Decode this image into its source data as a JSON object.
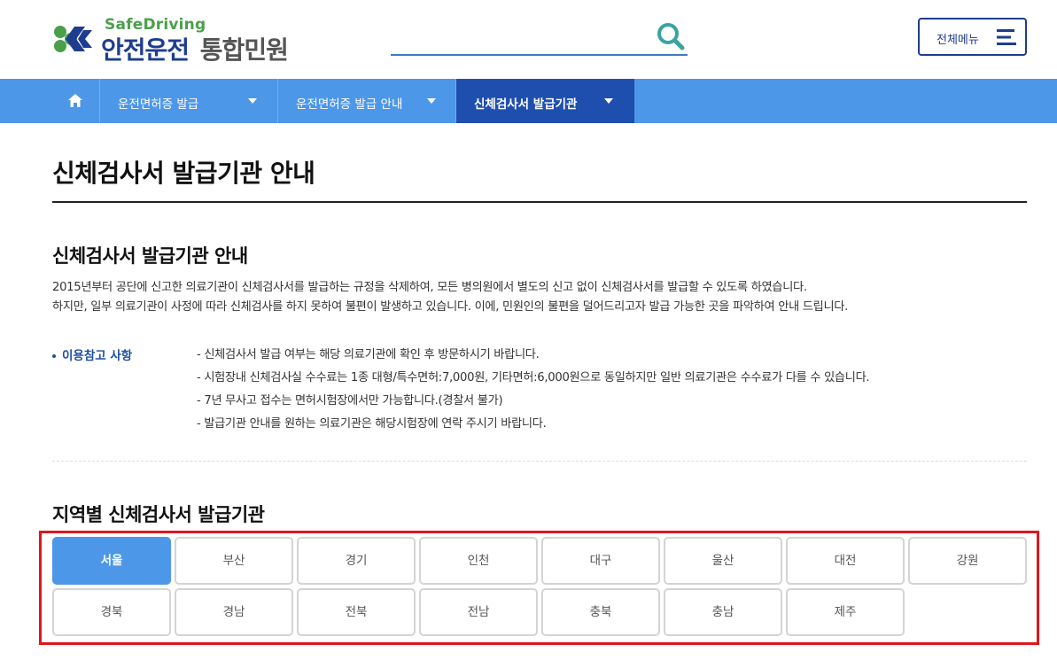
{
  "header": {
    "logo_small": "SafeDriving",
    "logo_main": "안전운전",
    "logo_sub": "통합민원",
    "search_placeholder": "",
    "allmenu_label": "전체메뉴"
  },
  "nav": {
    "items": [
      {
        "label": "운전면허증 발급",
        "active": false
      },
      {
        "label": "운전면허증 발급 안내",
        "active": false
      },
      {
        "label": "신체검사서 발급기관",
        "active": true
      }
    ]
  },
  "page_title": "신체검사서 발급기관 안내",
  "intro": {
    "title": "신체검사서 발급기관 안내",
    "lines": [
      "2015년부터 공단에 신고한 의료기관이 신체검사서를 발급하는 규정을 삭제하여, 모든 병의원에서 별도의 신고 없이 신체검사서를 발급할 수 있도록 하였습니다.",
      "하지만, 일부 의료기관이 사정에 따라 신체검사를 하지 못하여 불편이 발생하고 있습니다. 이에, 민원인의 불편을 덜어드리고자 발급 가능한 곳을 파악하여 안내 드립니다."
    ]
  },
  "reference": {
    "label": "이용참고 사항",
    "items": [
      "- 신체검사서 발급 여부는 해당 의료기관에 확인 후 방문하시기 바랍니다.",
      "- 시험장내 신체검사실 수수료는 1종 대형/특수면허:7,000원, 기타면허:6,000원으로 동일하지만 일반 의료기관은 수수료가 다를 수 있습니다.",
      "- 7년 무사고 접수는 면허시험장에서만 가능합니다.(경찰서 불가)",
      "- 발급기관 안내를 원하는 의료기관은 해당시험장에 연락 주시기 바랍니다."
    ]
  },
  "regions": {
    "title": "지역별 신체검사서 발급기관",
    "items": [
      {
        "label": "서울",
        "active": true
      },
      {
        "label": "부산",
        "active": false
      },
      {
        "label": "경기",
        "active": false
      },
      {
        "label": "인천",
        "active": false
      },
      {
        "label": "대구",
        "active": false
      },
      {
        "label": "울산",
        "active": false
      },
      {
        "label": "대전",
        "active": false
      },
      {
        "label": "강원",
        "active": false
      },
      {
        "label": "경북",
        "active": false
      },
      {
        "label": "경남",
        "active": false
      },
      {
        "label": "전북",
        "active": false
      },
      {
        "label": "전남",
        "active": false
      },
      {
        "label": "충북",
        "active": false
      },
      {
        "label": "충남",
        "active": false
      },
      {
        "label": "제주",
        "active": false
      }
    ]
  },
  "colors": {
    "brand_navy": "#1e3d8f",
    "brand_green": "#4aa04a",
    "nav_blue": "#4d97e8",
    "nav_active": "#1f4fae",
    "highlight_red": "#e0161e"
  },
  "icons": {
    "search": "search-icon",
    "menu": "hamburger-icon",
    "home": "home-icon",
    "caret": "chevron-down-icon"
  }
}
